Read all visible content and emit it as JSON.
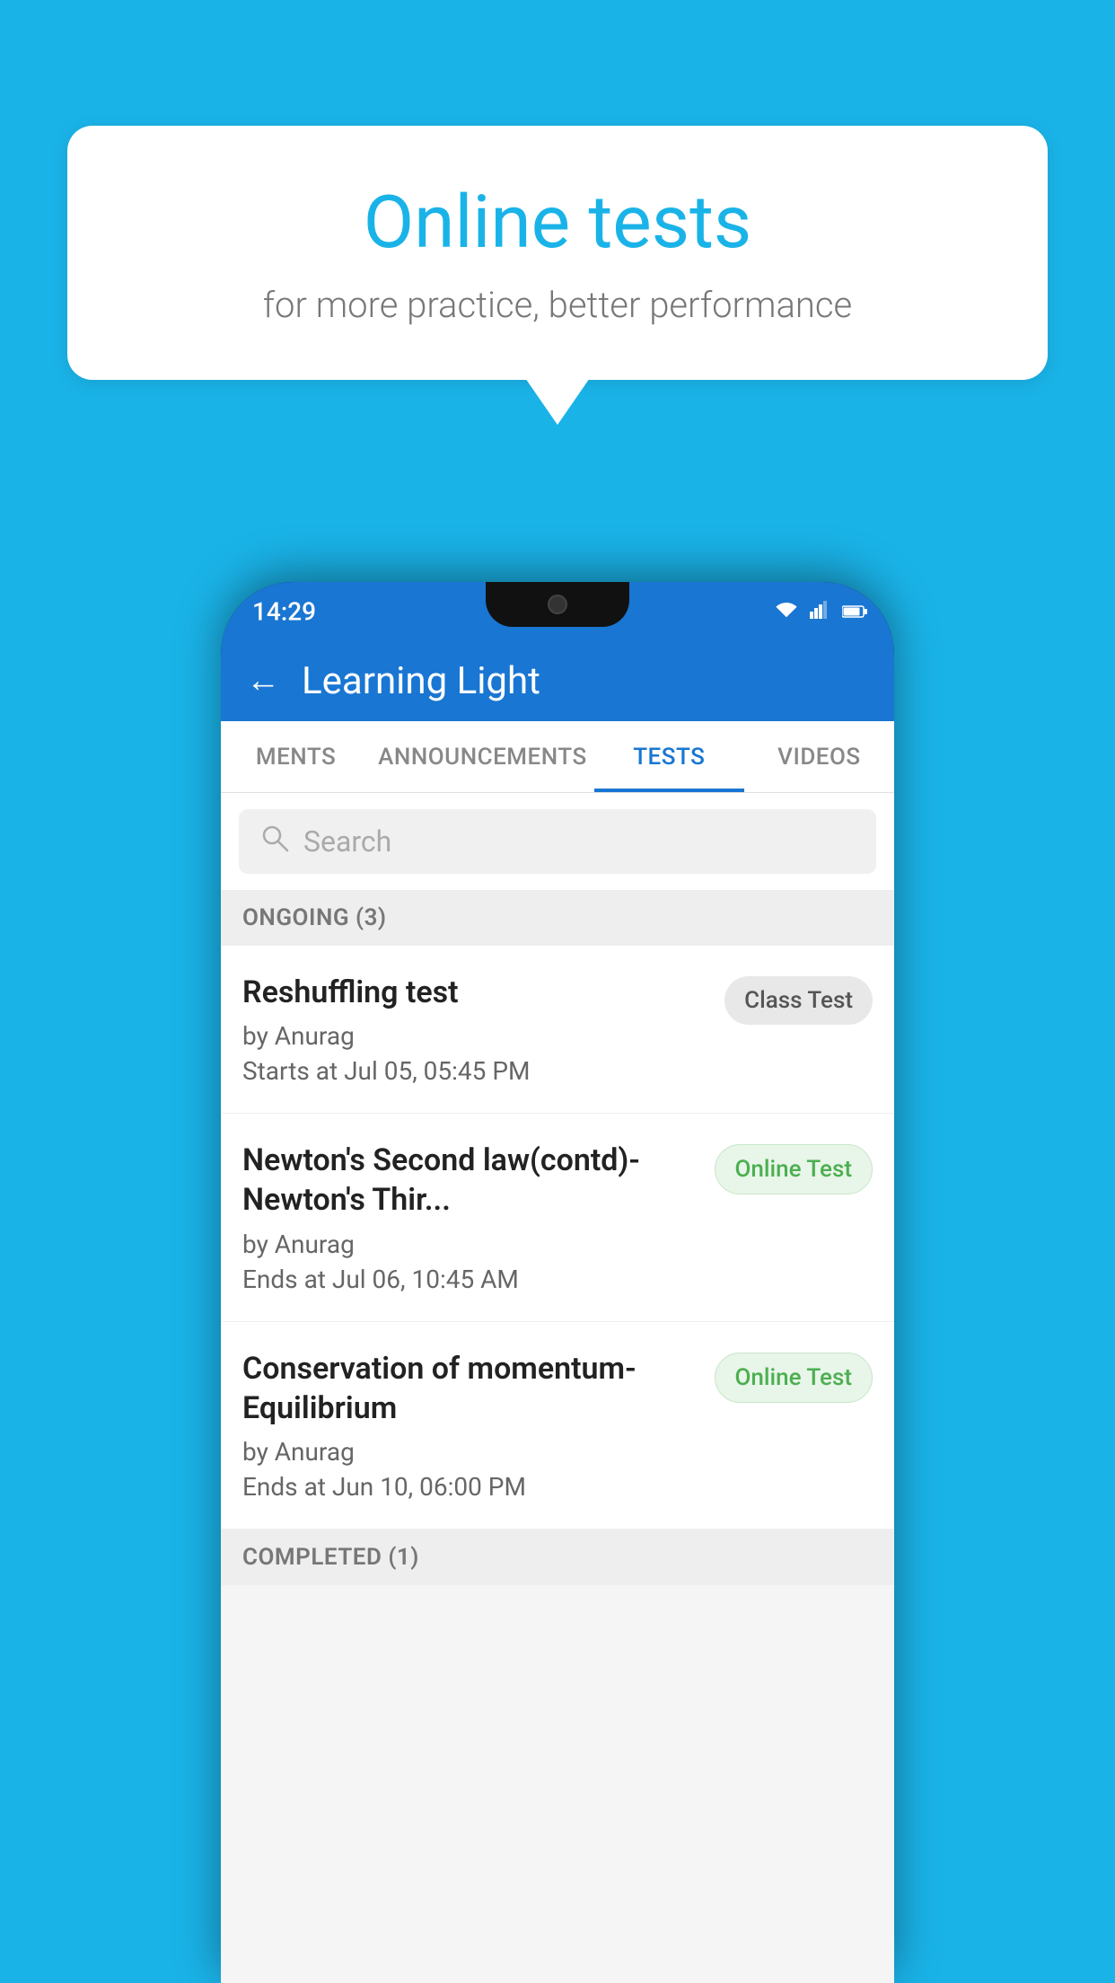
{
  "background": {
    "color": "#1ab3e8"
  },
  "speech_bubble": {
    "title": "Online tests",
    "subtitle": "for more practice, better performance"
  },
  "phone": {
    "status_bar": {
      "time": "14:29",
      "wifi": "▾",
      "signal": "▴",
      "battery": "▮"
    },
    "app_header": {
      "back_label": "←",
      "title": "Learning Light"
    },
    "tabs": [
      {
        "label": "MENTS",
        "active": false
      },
      {
        "label": "ANNOUNCEMENTS",
        "active": false
      },
      {
        "label": "TESTS",
        "active": true
      },
      {
        "label": "VIDEOS",
        "active": false
      }
    ],
    "search": {
      "placeholder": "Search"
    },
    "sections": [
      {
        "header": "ONGOING (3)",
        "tests": [
          {
            "name": "Reshuffling test",
            "author": "by Anurag",
            "date": "Starts at  Jul 05, 05:45 PM",
            "badge": "Class Test",
            "badge_type": "class"
          },
          {
            "name": "Newton's Second law(contd)-Newton's Thir...",
            "author": "by Anurag",
            "date": "Ends at  Jul 06, 10:45 AM",
            "badge": "Online Test",
            "badge_type": "online"
          },
          {
            "name": "Conservation of momentum-Equilibrium",
            "author": "by Anurag",
            "date": "Ends at  Jun 10, 06:00 PM",
            "badge": "Online Test",
            "badge_type": "online"
          }
        ]
      },
      {
        "header": "COMPLETED (1)",
        "tests": []
      }
    ]
  }
}
